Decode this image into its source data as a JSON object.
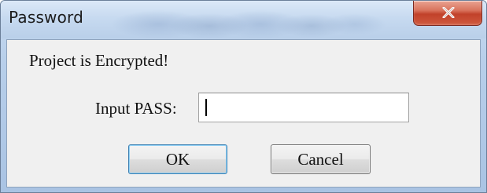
{
  "window": {
    "title": "Password",
    "close_icon": "close-x-icon"
  },
  "dialog": {
    "message": "Project is Encrypted!",
    "input_label": "Input PASS:",
    "input_value": "",
    "ok_label": "OK",
    "cancel_label": "Cancel"
  },
  "colors": {
    "close_button": "#c8452d",
    "client_background": "#f0f0f0",
    "ok_focus_border": "#3c7fb1"
  }
}
